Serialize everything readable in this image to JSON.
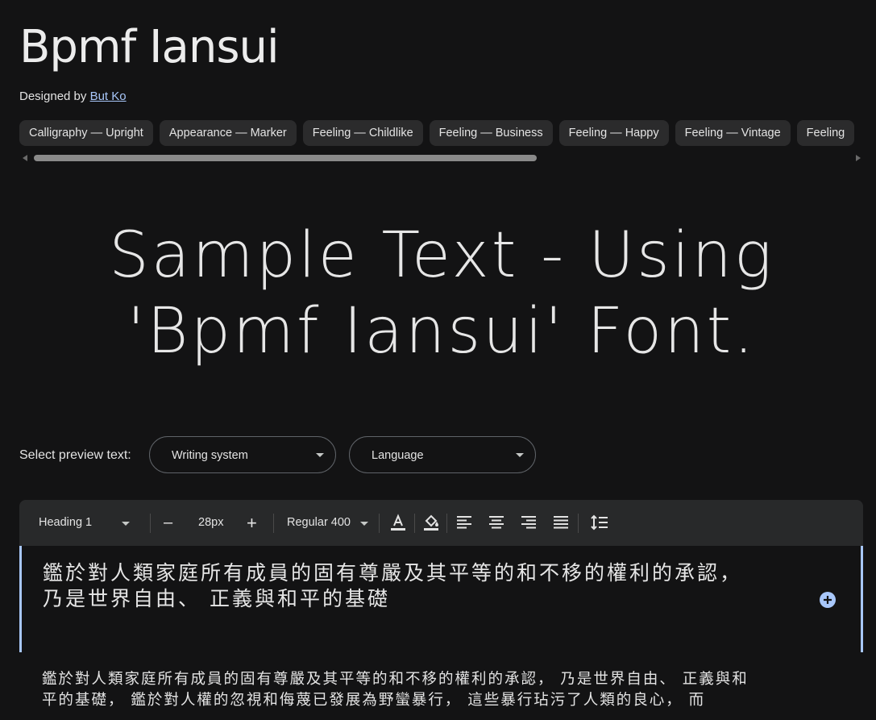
{
  "font": {
    "name": "Bpmf Iansui",
    "designer_prefix": "Designed by",
    "designer_name": "But Ko"
  },
  "tags": [
    "Calligraphy — Upright",
    "Appearance — Marker",
    "Feeling — Childlike",
    "Feeling — Business",
    "Feeling — Happy",
    "Feeling — Vintage",
    "Feeling"
  ],
  "sample_text": "Sample Text - Using 'Bpmf Iansui' Font.",
  "preview": {
    "label": "Select preview text:",
    "writing_system": "Writing system",
    "language": "Language"
  },
  "toolbar": {
    "style": "Heading 1",
    "size": "28px",
    "weight": "Regular 400",
    "decrease": "–",
    "increase": "+"
  },
  "editor_heading": "鑑於對人類家庭所有成員的固有尊嚴及其平等的和不移的權利的承認， 乃是世界自由、 正義與和平的基礎",
  "editor_paragraph": "鑑於對人類家庭所有成員的固有尊嚴及其平等的和不移的權利的承認， 乃是世界自由、 正義與和平的基礎， 鑑於對人權的忽視和侮蔑已發展為野蠻暴行， 這些暴行玷污了人類的良心， 而",
  "colors": {
    "background": "#131314",
    "toolbar": "#28292a",
    "accent": "#a8c7fa"
  }
}
